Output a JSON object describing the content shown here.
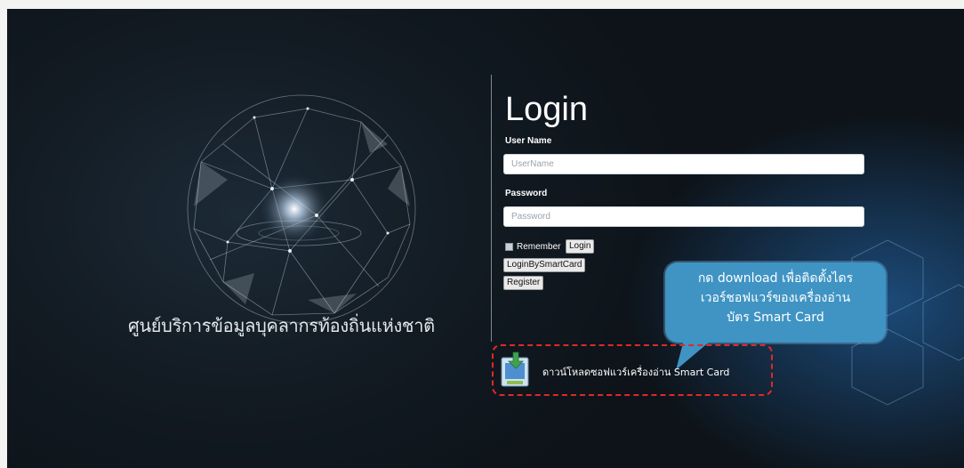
{
  "login": {
    "title": "Login",
    "username_label": "User Name",
    "username_placeholder": "UserName",
    "password_label": "Password",
    "password_placeholder": "Password",
    "remember_label": "Remember",
    "login_button": "Login",
    "smartcard_button": "LoginBySmartCard",
    "register_button": "Register"
  },
  "brand": {
    "caption": "ศูนย์บริการข้อมูลบุคลากรท้องถิ่นแห่งชาติ"
  },
  "callout": {
    "line1": "กด download เพื่อติดตั้งไดร",
    "line2": "เวอร์ชอฟแวร์ของเครื่องอ่าน",
    "line3": "บัตร Smart Card"
  },
  "download": {
    "label": "ดาวน์โหลดซอฟแวร์เครื่องอ่าน Smart Card"
  },
  "colors": {
    "background": "#121a22",
    "callout": "#3f94c4",
    "highlight_border": "#e02828",
    "text": "#ffffff"
  }
}
